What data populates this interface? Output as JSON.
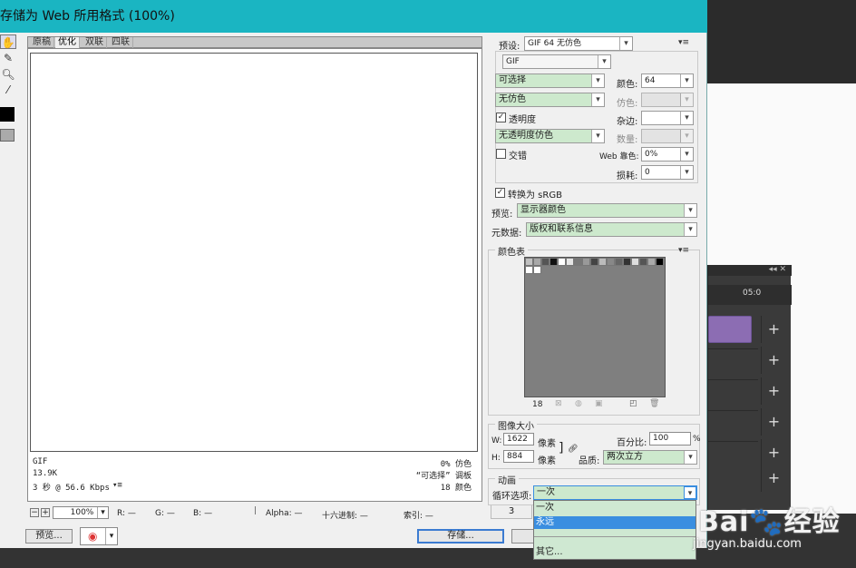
{
  "dialog": {
    "title": "存储为 Web 所用格式 (100%)"
  },
  "tabs": [
    "原稿",
    "优化",
    "双联",
    "四联"
  ],
  "preview_info": {
    "format": "GIF",
    "size": "13.9K",
    "time": "3 秒 @ 56.6 Kbps",
    "dither_pct": "0% 仿色",
    "palette": "“可选择” 调板",
    "colors": "18 颜色"
  },
  "status": {
    "zoom": "100%",
    "r": "R: —",
    "g": "G: —",
    "b": "B: —",
    "alpha": "Alpha: —",
    "hex": "十六进制: —",
    "index": "索引: —"
  },
  "buttons": {
    "preview": "预览...",
    "save": "存储...",
    "partial": "3"
  },
  "settings": {
    "preset_label": "预设:",
    "preset_value": "GIF 64 无仿色",
    "format_value": "GIF",
    "reduction_value": "可选择",
    "colors_label": "颜色:",
    "colors_value": "64",
    "dither_value": "无仿色",
    "dither_pct_label": "仿色:",
    "transparency_label": "透明度",
    "matte_label": "杂边:",
    "trans_dither_value": "无透明度仿色",
    "amount_label": "数量:",
    "interlaced_label": "交错",
    "web_snap_label": "Web 靠色:",
    "web_snap_value": "0%",
    "lossy_label": "损耗:",
    "lossy_value": "0",
    "srgb_label": "转换为 sRGB",
    "preview_label": "预览:",
    "preview_value": "显示器颜色",
    "metadata_label": "元数据:",
    "metadata_value": "版权和联系信息"
  },
  "color_table": {
    "title": "颜色表",
    "count": "18"
  },
  "image_size": {
    "title": "图像大小",
    "w_label": "W:",
    "w_value": "1622",
    "h_label": "H:",
    "h_value": "884",
    "unit": "像素",
    "percent_label": "百分比:",
    "percent_value": "100",
    "percent_unit": "%",
    "quality_label": "品质:",
    "quality_value": "两次立方"
  },
  "animation": {
    "title": "动画",
    "loop_label": "循环选项:",
    "loop_value": "一次",
    "options": [
      "一次",
      "永远",
      "",
      "其它..."
    ],
    "highlighted_index": 1
  },
  "background": {
    "timeline_marker": "05:0"
  },
  "watermark": {
    "text": "Bai🐾经验",
    "url": "jingyan.baidu.com"
  }
}
